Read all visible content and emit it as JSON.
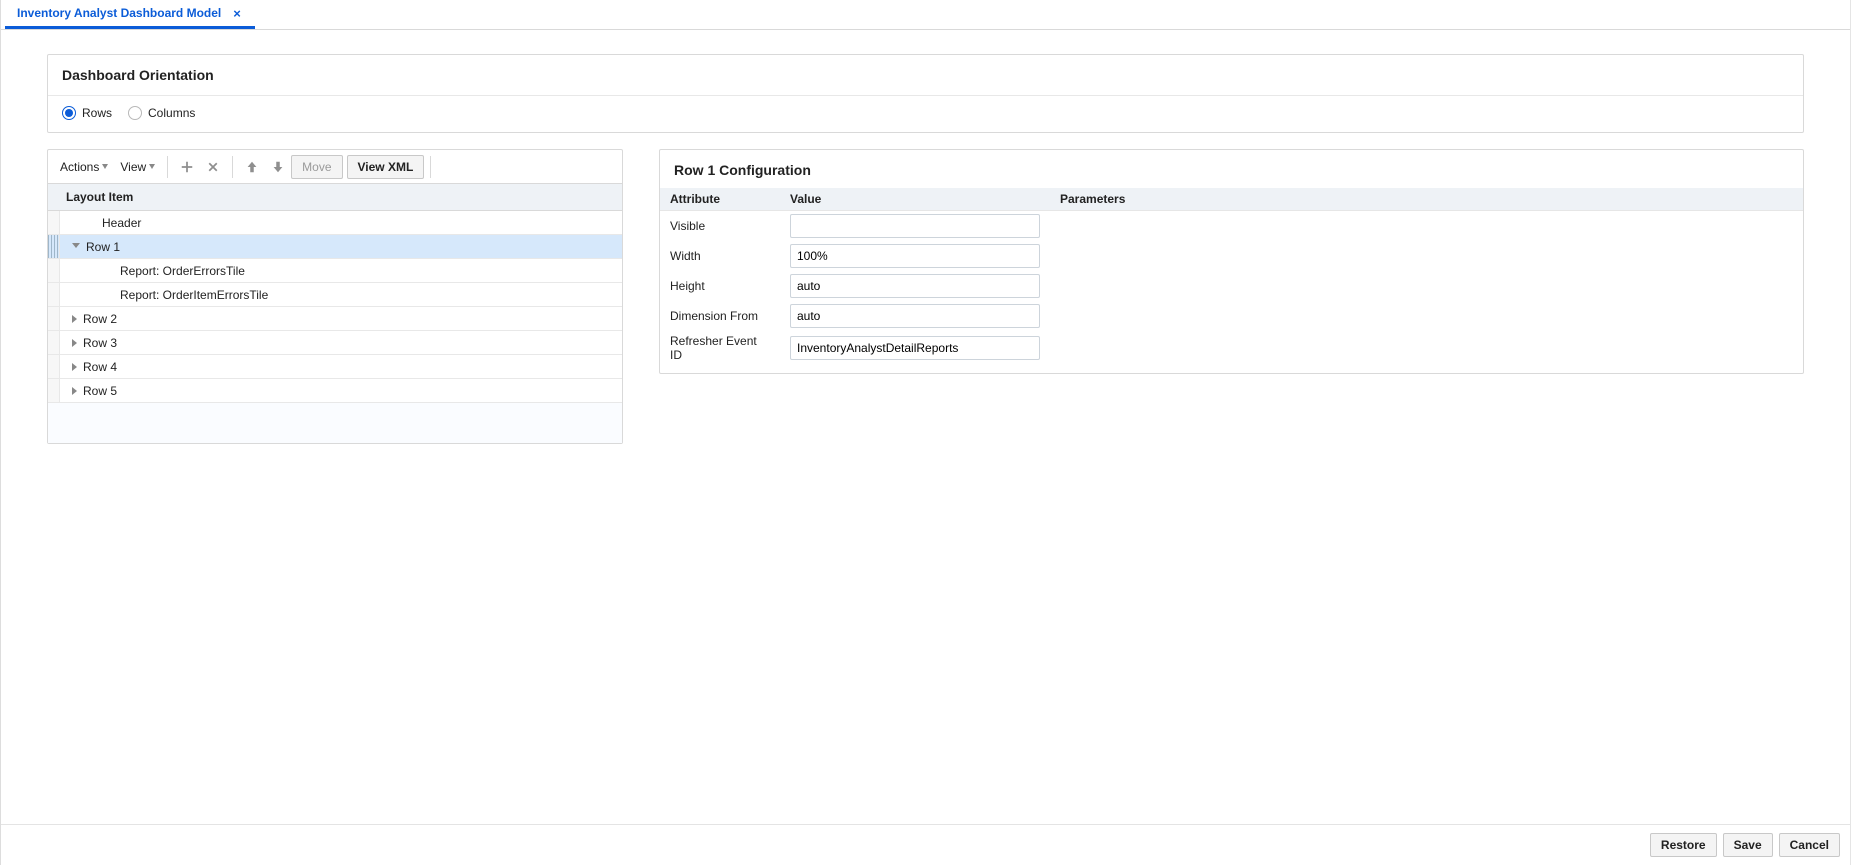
{
  "tab": {
    "label": "Inventory Analyst Dashboard Model"
  },
  "orientation": {
    "title": "Dashboard Orientation",
    "rows_label": "Rows",
    "columns_label": "Columns",
    "selected": "rows"
  },
  "toolbar": {
    "actions_label": "Actions",
    "view_label": "View",
    "move_label": "Move",
    "view_xml_label": "View XML"
  },
  "tree": {
    "header": "Layout Item",
    "items": [
      {
        "label": "Header",
        "level": 1,
        "expand": "none",
        "selected": false
      },
      {
        "label": "Row 1",
        "level": 1,
        "expand": "open",
        "selected": true
      },
      {
        "label": "Report: OrderErrorsTile",
        "level": 2,
        "expand": "none",
        "selected": false
      },
      {
        "label": "Report: OrderItemErrorsTile",
        "level": 2,
        "expand": "none",
        "selected": false
      },
      {
        "label": "Row 2",
        "level": 1,
        "expand": "closed",
        "selected": false
      },
      {
        "label": "Row 3",
        "level": 1,
        "expand": "closed",
        "selected": false
      },
      {
        "label": "Row 4",
        "level": 1,
        "expand": "closed",
        "selected": false
      },
      {
        "label": "Row 5",
        "level": 1,
        "expand": "closed",
        "selected": false
      }
    ]
  },
  "config": {
    "title": "Row 1 Configuration",
    "columns": {
      "attribute": "Attribute",
      "value": "Value",
      "parameters": "Parameters"
    },
    "rows": [
      {
        "attr": "Visible",
        "value": ""
      },
      {
        "attr": "Width",
        "value": "100%"
      },
      {
        "attr": "Height",
        "value": "auto"
      },
      {
        "attr": "Dimension From",
        "value": "auto"
      },
      {
        "attr": "Refresher Event ID",
        "value": "InventoryAnalystDetailReports"
      }
    ]
  },
  "footer": {
    "restore_label": "Restore",
    "save_label": "Save",
    "cancel_label": "Cancel"
  }
}
